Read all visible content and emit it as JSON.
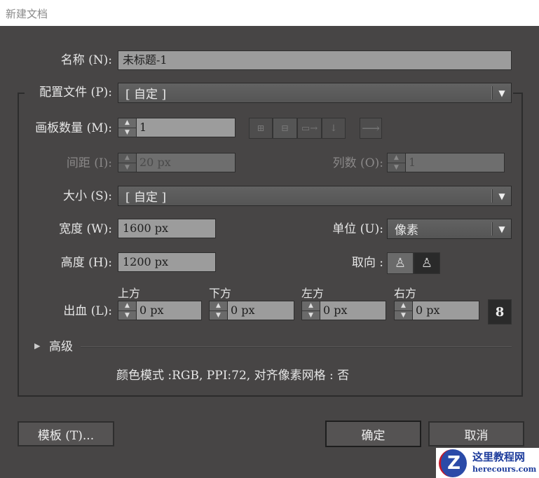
{
  "window": {
    "title": "新建文档"
  },
  "name": {
    "label": "名称 (N):",
    "value": "未标题-1"
  },
  "profile": {
    "label": "配置文件 (P):",
    "value": "[ 自定 ]"
  },
  "artboards": {
    "label": "画板数量 (M):",
    "value": "1",
    "layout_icons": [
      "grid-by-row-icon",
      "grid-by-column-icon",
      "arrange-by-row-icon",
      "arrange-by-column-icon"
    ],
    "direction_icon": "arrow-right-icon"
  },
  "spacing": {
    "label": "间距 (I):",
    "value": "20 px"
  },
  "columns": {
    "label": "列数 (O):",
    "value": "1"
  },
  "size": {
    "label": "大小 (S):",
    "value": "[ 自定 ]"
  },
  "width": {
    "label": "宽度 (W):",
    "value": "1600 px"
  },
  "height": {
    "label": "高度 (H):",
    "value": "1200 px"
  },
  "units": {
    "label": "单位 (U):",
    "value": "像素"
  },
  "orientation": {
    "label": "取向 :",
    "selected": "portrait"
  },
  "bleed": {
    "label": "出血 (L):",
    "top_label": "上方",
    "bottom_label": "下方",
    "left_label": "左方",
    "right_label": "右方",
    "top": "0 px",
    "bottom": "0 px",
    "left": "0 px",
    "right": "0 px",
    "linked": true
  },
  "advanced": {
    "label": "高级"
  },
  "info": "颜色模式 :RGB, PPI:72, 对齐像素网格 : 否",
  "buttons": {
    "templates": "模板 (T)...",
    "ok": "确定",
    "cancel": "取消"
  },
  "watermark": {
    "title": "这里教程网",
    "url": "herecours.com"
  }
}
